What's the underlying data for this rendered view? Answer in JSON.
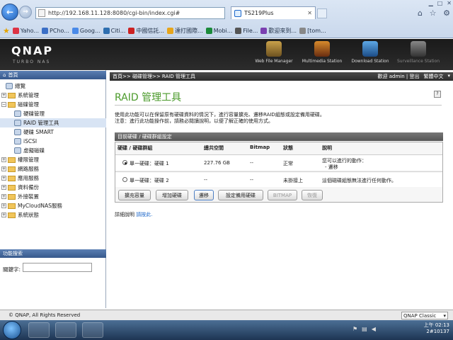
{
  "browser": {
    "url": "http://192.168.11.128:8080/cgi-bin/index.cgi#",
    "tab_title": "TS219Plus",
    "favorites": [
      "Yaho...",
      "PCho...",
      "Goog...",
      "Citi...",
      "中國信託...",
      "達打國際...",
      "Mobi...",
      "File...",
      "歡迎來到...",
      "[tom..."
    ]
  },
  "qnap": {
    "logo": "QNAP",
    "subtitle": "TURBO NAS",
    "apps": [
      "Web File Manager",
      "Multimedia Station",
      "Download Station",
      "Surveillance Station"
    ]
  },
  "sidebar": {
    "header": "首頁",
    "items": [
      {
        "label": "總覽",
        "level": 1
      },
      {
        "label": "系統管理",
        "level": 0
      },
      {
        "label": "磁碟管理",
        "level": 0
      },
      {
        "label": "硬碟管理",
        "level": 1
      },
      {
        "label": "RAID 管理工具",
        "level": 1
      },
      {
        "label": "硬碟 SMART",
        "level": 1
      },
      {
        "label": "iSCSI",
        "level": 1
      },
      {
        "label": "虛擬磁碟",
        "level": 1
      },
      {
        "label": "權限管理",
        "level": 0
      },
      {
        "label": "網路服務",
        "level": 0
      },
      {
        "label": "應用服務",
        "level": 0
      },
      {
        "label": "資料備份",
        "level": 0
      },
      {
        "label": "外接裝置",
        "level": 0
      },
      {
        "label": "MyCloudNAS服務",
        "level": 0
      },
      {
        "label": "系統狀態",
        "level": 0
      }
    ],
    "search_header": "功能搜索",
    "keyword_label": "關鍵字:"
  },
  "main": {
    "breadcrumb": "首頁>> 磁碟管理>> RAID 管理工具",
    "welcome": "歡迎 admin | 登出",
    "language": "繁體中文",
    "title": "RAID 管理工具",
    "desc1": "使用此功能可以在保留原有硬碟資料的情況下，進行容量擴充、遷移RAID組態或設定備用硬碟。",
    "desc2": "注意：進行此功能操作前，請務必閱讀說明，以便了解正確的使用方式。",
    "table_title": "目前硬碟 / 硬碟群組設定",
    "columns": [
      "硬碟 / 硬碟群組",
      "總共空間",
      "Bitmap",
      "狀態",
      "說明"
    ],
    "rows": [
      {
        "name": "單一硬碟：硬碟 1",
        "space": "227.76 GB",
        "bitmap": "--",
        "status": "正常",
        "note1": "您可以進行的動作：",
        "note2": "- 遷移",
        "selected": true
      },
      {
        "name": "單一硬碟：硬碟 2",
        "space": "--",
        "bitmap": "--",
        "status": "未掛接上",
        "note1": "這個磁碟組態無法進行任何動作。",
        "note2": "",
        "selected": false
      }
    ],
    "buttons": [
      "擴充容量",
      "增加硬碟",
      "遷移",
      "設定備用硬碟",
      "BITMAP",
      "恢復"
    ],
    "detail_label": "詳細說明",
    "detail_link": "請按此."
  },
  "footer": {
    "copyright": "© QNAP, All Rights Reserved",
    "theme": "QNAP Classic"
  },
  "taskbar": {
    "time": "上午 02:13",
    "date": "2#10137"
  }
}
